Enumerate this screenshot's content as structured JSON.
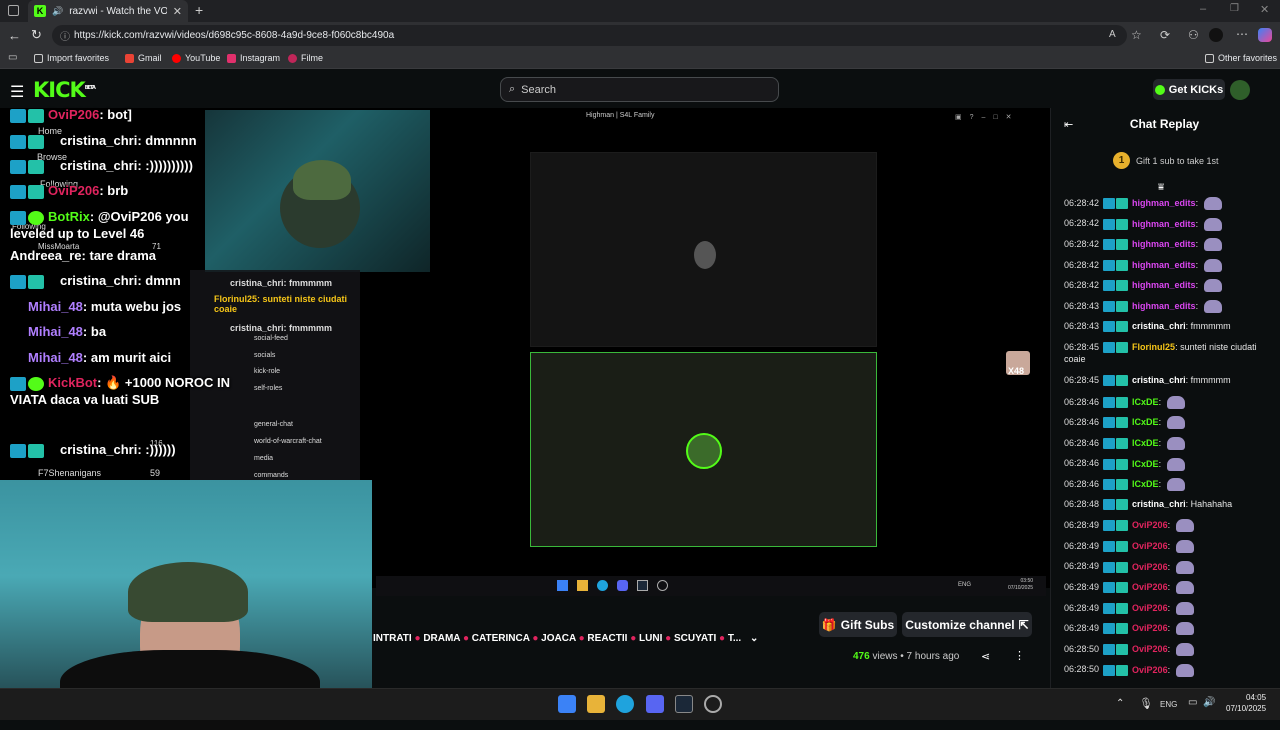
{
  "browser": {
    "tab_title": "razvwi - Watch the VOD on K",
    "url": "https://kick.com/razvwi/videos/d698c95c-8608-4a9d-9ce8-f060c8bc490a",
    "favorites": [
      "Import favorites",
      "Gmail",
      "YouTube",
      "Instagram",
      "Filme"
    ],
    "other_favorites": "Other favorites"
  },
  "kick": {
    "logo": "KICK",
    "beta": "BETA",
    "search_placeholder": "Search",
    "get_kicks": "Get KICKs"
  },
  "overlay_chat": [
    {
      "user": "OviP206",
      "text": "bot]",
      "color": "#e0245e"
    },
    {
      "user": "cristina_chri",
      "text": "dmnnnn",
      "color": "#ffffff"
    },
    {
      "user": "cristina_chri",
      "text": ":))))))))))",
      "color": "#ffffff"
    },
    {
      "user": "OviP206",
      "text": "brb",
      "color": "#e0245e"
    },
    {
      "user": "BotRix",
      "text": "@OviP206 you leveled up to Level 46",
      "color": "#53fc18"
    },
    {
      "user": "Andreea_re",
      "text": "tare drama",
      "color": "#ffffff"
    },
    {
      "user": "cristina_chri",
      "text": "dmnn",
      "color": "#ffffff"
    },
    {
      "user": "Mihai_48",
      "text": "muta webu jos",
      "color": "#b07fff"
    },
    {
      "user": "Mihai_48",
      "text": "ba",
      "color": "#b07fff"
    },
    {
      "user": "Mihai_48",
      "text": "am murit aici",
      "color": "#b07fff"
    },
    {
      "user": "KickBot",
      "text": "🔥 +1000 NOROC IN VIATA daca va luati SUB",
      "color": "#e0245e"
    },
    {
      "user": "cristina_chri",
      "text": ":))))))",
      "color": "#ffffff"
    }
  ],
  "sidebar_ghost": {
    "home": "Home",
    "browse": "Browse",
    "following": "Following",
    "following2": "Following",
    "user1": "MissMoarta",
    "user1_count": "71",
    "user2": "F7Shenanigans",
    "user2_count": "59",
    "user3_count": "116"
  },
  "inner_window": {
    "title": "Highman | S4L Family",
    "clock_time": "03:50",
    "clock_date": "07/10/2025",
    "lang": "ENG",
    "viewer_badge": "X48",
    "discord_lines": [
      "cristina_chri: fmmmmm",
      "Florinul25: sunteti niste ciudati coaie",
      "cristina_chri: fmmmmm"
    ],
    "discord_channels": [
      "social-feed",
      "socials",
      "kick-role",
      "self-roles",
      "general-chat",
      "world-of-warcraft-chat",
      "media",
      "commands"
    ]
  },
  "below_stream": {
    "tags": [
      "INTRATI",
      "DRAMA",
      "CATERINCA",
      "JOACA",
      "REACTII",
      "LUNI",
      "SCUYATI",
      "T..."
    ],
    "gift_subs": "Gift Subs",
    "customize": "Customize channel",
    "views_count": "476",
    "views_label": "views",
    "age": "7 hours ago"
  },
  "chat": {
    "title": "Chat Replay",
    "gift_text": "Gift 1 sub to take 1st",
    "gift_count": "1",
    "messages": [
      {
        "ts": "06:28:42",
        "user": "highman_edits",
        "text": "",
        "color": "#d946ef",
        "emote": true
      },
      {
        "ts": "06:28:42",
        "user": "highman_edits",
        "text": "",
        "color": "#d946ef",
        "emote": true
      },
      {
        "ts": "06:28:42",
        "user": "highman_edits",
        "text": "",
        "color": "#d946ef",
        "emote": true
      },
      {
        "ts": "06:28:42",
        "user": "highman_edits",
        "text": "",
        "color": "#d946ef",
        "emote": true
      },
      {
        "ts": "06:28:42",
        "user": "highman_edits",
        "text": "",
        "color": "#d946ef",
        "emote": true
      },
      {
        "ts": "06:28:43",
        "user": "highman_edits",
        "text": "",
        "color": "#d946ef",
        "emote": true
      },
      {
        "ts": "06:28:43",
        "user": "cristina_chri",
        "text": "fmmmmm",
        "color": "#ffffff",
        "emote": false
      },
      {
        "ts": "06:28:45",
        "user": "Florinul25",
        "text": "sunteti niste ciudati coaie",
        "color": "#f5c518",
        "emote": false
      },
      {
        "ts": "06:28:45",
        "user": "cristina_chri",
        "text": "fmmmmm",
        "color": "#ffffff",
        "emote": false
      },
      {
        "ts": "06:28:46",
        "user": "lCxDE",
        "text": "",
        "color": "#53fc18",
        "emote": true
      },
      {
        "ts": "06:28:46",
        "user": "lCxDE",
        "text": "",
        "color": "#53fc18",
        "emote": true
      },
      {
        "ts": "06:28:46",
        "user": "lCxDE",
        "text": "",
        "color": "#53fc18",
        "emote": true
      },
      {
        "ts": "06:28:46",
        "user": "lCxDE",
        "text": "",
        "color": "#53fc18",
        "emote": true
      },
      {
        "ts": "06:28:46",
        "user": "lCxDE",
        "text": "",
        "color": "#53fc18",
        "emote": true
      },
      {
        "ts": "06:28:48",
        "user": "cristina_chri",
        "text": "Hahahaha",
        "color": "#ffffff",
        "emote": false
      },
      {
        "ts": "06:28:49",
        "user": "OviP206",
        "text": "",
        "color": "#e0245e",
        "emote": true
      },
      {
        "ts": "06:28:49",
        "user": "OviP206",
        "text": "",
        "color": "#e0245e",
        "emote": true
      },
      {
        "ts": "06:28:49",
        "user": "OviP206",
        "text": "",
        "color": "#e0245e",
        "emote": true
      },
      {
        "ts": "06:28:49",
        "user": "OviP206",
        "text": "",
        "color": "#e0245e",
        "emote": true
      },
      {
        "ts": "06:28:49",
        "user": "OviP206",
        "text": "",
        "color": "#e0245e",
        "emote": true
      },
      {
        "ts": "06:28:49",
        "user": "OviP206",
        "text": "",
        "color": "#e0245e",
        "emote": true
      },
      {
        "ts": "06:28:50",
        "user": "OviP206",
        "text": "",
        "color": "#e0245e",
        "emote": true
      },
      {
        "ts": "06:28:50",
        "user": "OviP206",
        "text": "",
        "color": "#e0245e",
        "emote": true
      }
    ]
  },
  "taskbar": {
    "lang": "ENG",
    "time": "04:05",
    "date": "07/10/2025"
  }
}
